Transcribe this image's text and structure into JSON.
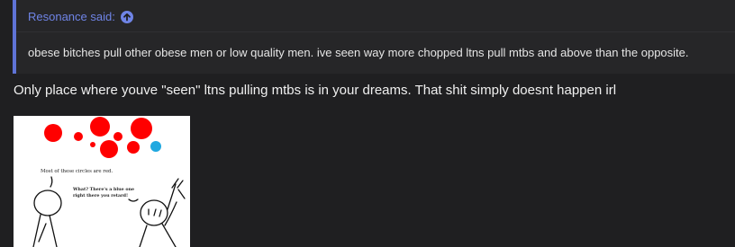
{
  "quote": {
    "author": "Resonance",
    "said_label": "said:",
    "jump_icon": "arrow-up-circle-icon",
    "body": "obese bitches pull other obese men or low quality men. ive seen way more chopped ltns pull mtbs and above than the opposite."
  },
  "reply": {
    "text": "Only place where youve \"seen\" ltns pulling mtbs is in your dreams. That shit simply doesnt happen irl"
  },
  "meme": {
    "caption_left": "Most of these circles are red.",
    "caption_right_line1": "What? There's a blue one",
    "caption_right_line2": "right there you retard!",
    "colors": {
      "red": "#ff0000",
      "blue": "#20a8e0"
    }
  },
  "colors": {
    "accent": "#6f84e6",
    "background": "#1f1f21",
    "quote_background": "#262628"
  }
}
